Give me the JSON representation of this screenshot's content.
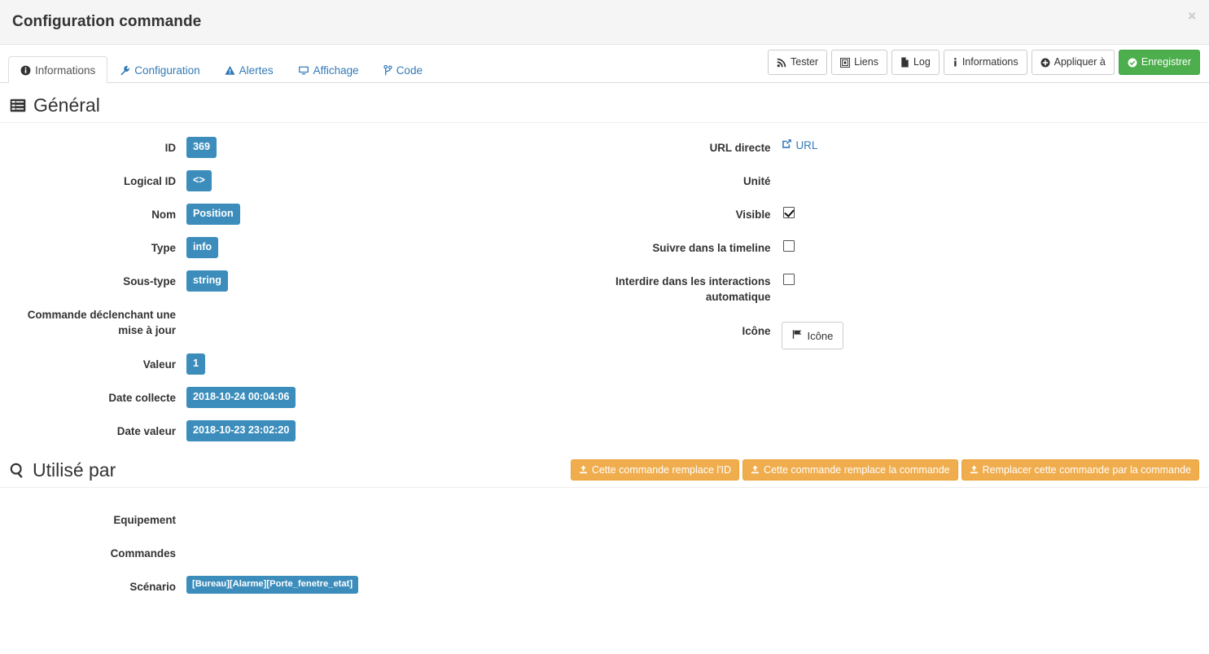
{
  "header": {
    "title": "Configuration commande",
    "close_label": "×"
  },
  "tabs": [
    {
      "label": "Informations",
      "icon": "info-circle-icon",
      "active": true
    },
    {
      "label": "Configuration",
      "icon": "wrench-icon",
      "active": false
    },
    {
      "label": "Alertes",
      "icon": "warning-triangle-icon",
      "active": false
    },
    {
      "label": "Affichage",
      "icon": "desktop-icon",
      "active": false
    },
    {
      "label": "Code",
      "icon": "code-branch-icon",
      "active": false
    }
  ],
  "toolbar": [
    {
      "label": "Tester",
      "icon": "rss-icon",
      "style": "default"
    },
    {
      "label": "Liens",
      "icon": "sitemap-icon",
      "style": "default"
    },
    {
      "label": "Log",
      "icon": "file-icon",
      "style": "default"
    },
    {
      "label": "Informations",
      "icon": "info-icon",
      "style": "default"
    },
    {
      "label": "Appliquer à",
      "icon": "plus-circle-icon",
      "style": "default"
    },
    {
      "label": "Enregistrer",
      "icon": "check-circle-icon",
      "style": "success"
    }
  ],
  "general": {
    "heading": "Général",
    "heading_icon": "list-alt-icon",
    "left": {
      "id_label": "ID",
      "id_value": "369",
      "logical_id_label": "Logical ID",
      "logical_id_value": "<>",
      "nom_label": "Nom",
      "nom_value": "Position",
      "type_label": "Type",
      "type_value": "info",
      "sous_type_label": "Sous-type",
      "sous_type_value": "string",
      "trigger_label": "Commande déclenchant une mise à jour",
      "trigger_value": "",
      "valeur_label": "Valeur",
      "valeur_value": "1",
      "date_collecte_label": "Date collecte",
      "date_collecte_value": "2018-10-24 00:04:06",
      "date_valeur_label": "Date valeur",
      "date_valeur_value": "2018-10-23 23:02:20"
    },
    "right": {
      "url_label": "URL directe",
      "url_link_text": "URL",
      "url_link_icon": "external-link-icon",
      "unite_label": "Unité",
      "unite_value": "",
      "visible_label": "Visible",
      "visible_checked": true,
      "timeline_label": "Suivre dans la timeline",
      "timeline_checked": false,
      "interdire_label": "Interdire dans les interactions automatique",
      "interdire_checked": false,
      "icone_label": "Icône",
      "icone_button_label": "Icône",
      "icone_button_icon": "flag-icon"
    }
  },
  "used_by": {
    "heading": "Utilisé par",
    "heading_icon": "search-icon",
    "actions": [
      {
        "label": "Cette commande remplace l'ID",
        "icon": "upload-icon"
      },
      {
        "label": "Cette commande remplace la commande",
        "icon": "upload-icon"
      },
      {
        "label": "Remplacer cette commande par la commande",
        "icon": "upload-icon"
      }
    ],
    "equipement_label": "Equipement",
    "equipement_value": "",
    "commandes_label": "Commandes",
    "commandes_value": "",
    "scenario_label": "Scénario",
    "scenario_value": "[Bureau][Alarme][Porte_fenetre_etat]"
  },
  "colors": {
    "badge_blue": "#3c8dbc",
    "link_blue": "#337ab7",
    "success_green": "#4cae4c",
    "warning_orange": "#f0ad4e",
    "header_bg": "#f5f5f5"
  }
}
